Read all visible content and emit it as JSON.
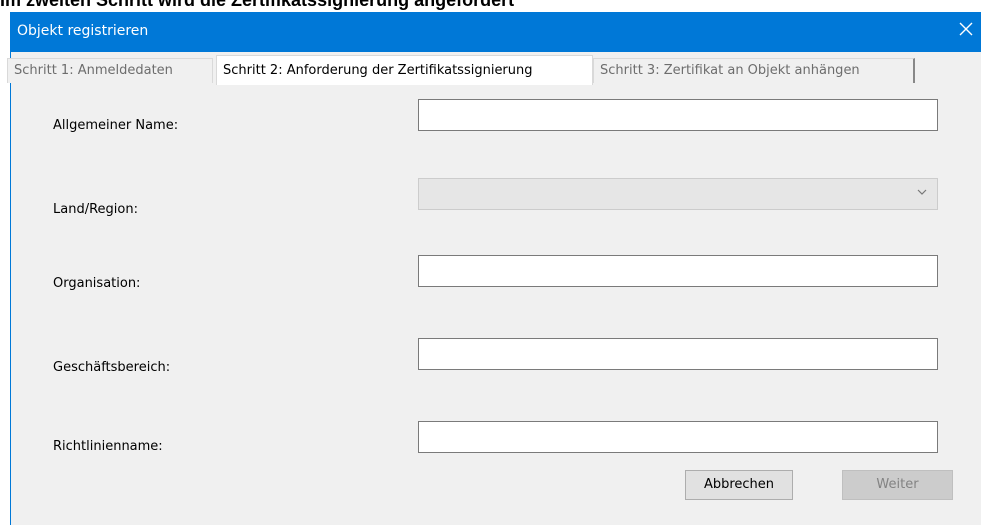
{
  "caption": "Im zweiten Schritt wird die Zertifikatssignierung angefordert",
  "window": {
    "title": "Objekt registrieren",
    "close_icon": "close-icon"
  },
  "tabs": [
    {
      "label": "Schritt 1: Anmeldedaten",
      "active": false
    },
    {
      "label": "Schritt 2: Anforderung der Zertifikatssignierung",
      "active": true
    },
    {
      "label": "Schritt 3: Zertifikat an Objekt anhängen",
      "active": false
    }
  ],
  "form": {
    "common_name": {
      "label": "Allgemeiner Name:",
      "value": ""
    },
    "country": {
      "label": "Land/Region:",
      "value": "",
      "disabled": true
    },
    "organization": {
      "label": "Organisation:",
      "value": ""
    },
    "business_unit": {
      "label": "Geschäftsbereich:",
      "value": ""
    },
    "policy_name": {
      "label": "Richtlinienname:",
      "value": ""
    }
  },
  "buttons": {
    "cancel": "Abbrechen",
    "next": "Weiter",
    "next_disabled": true
  },
  "colors": {
    "titlebar": "#0078d7",
    "dialog_bg": "#f0f0f0"
  }
}
